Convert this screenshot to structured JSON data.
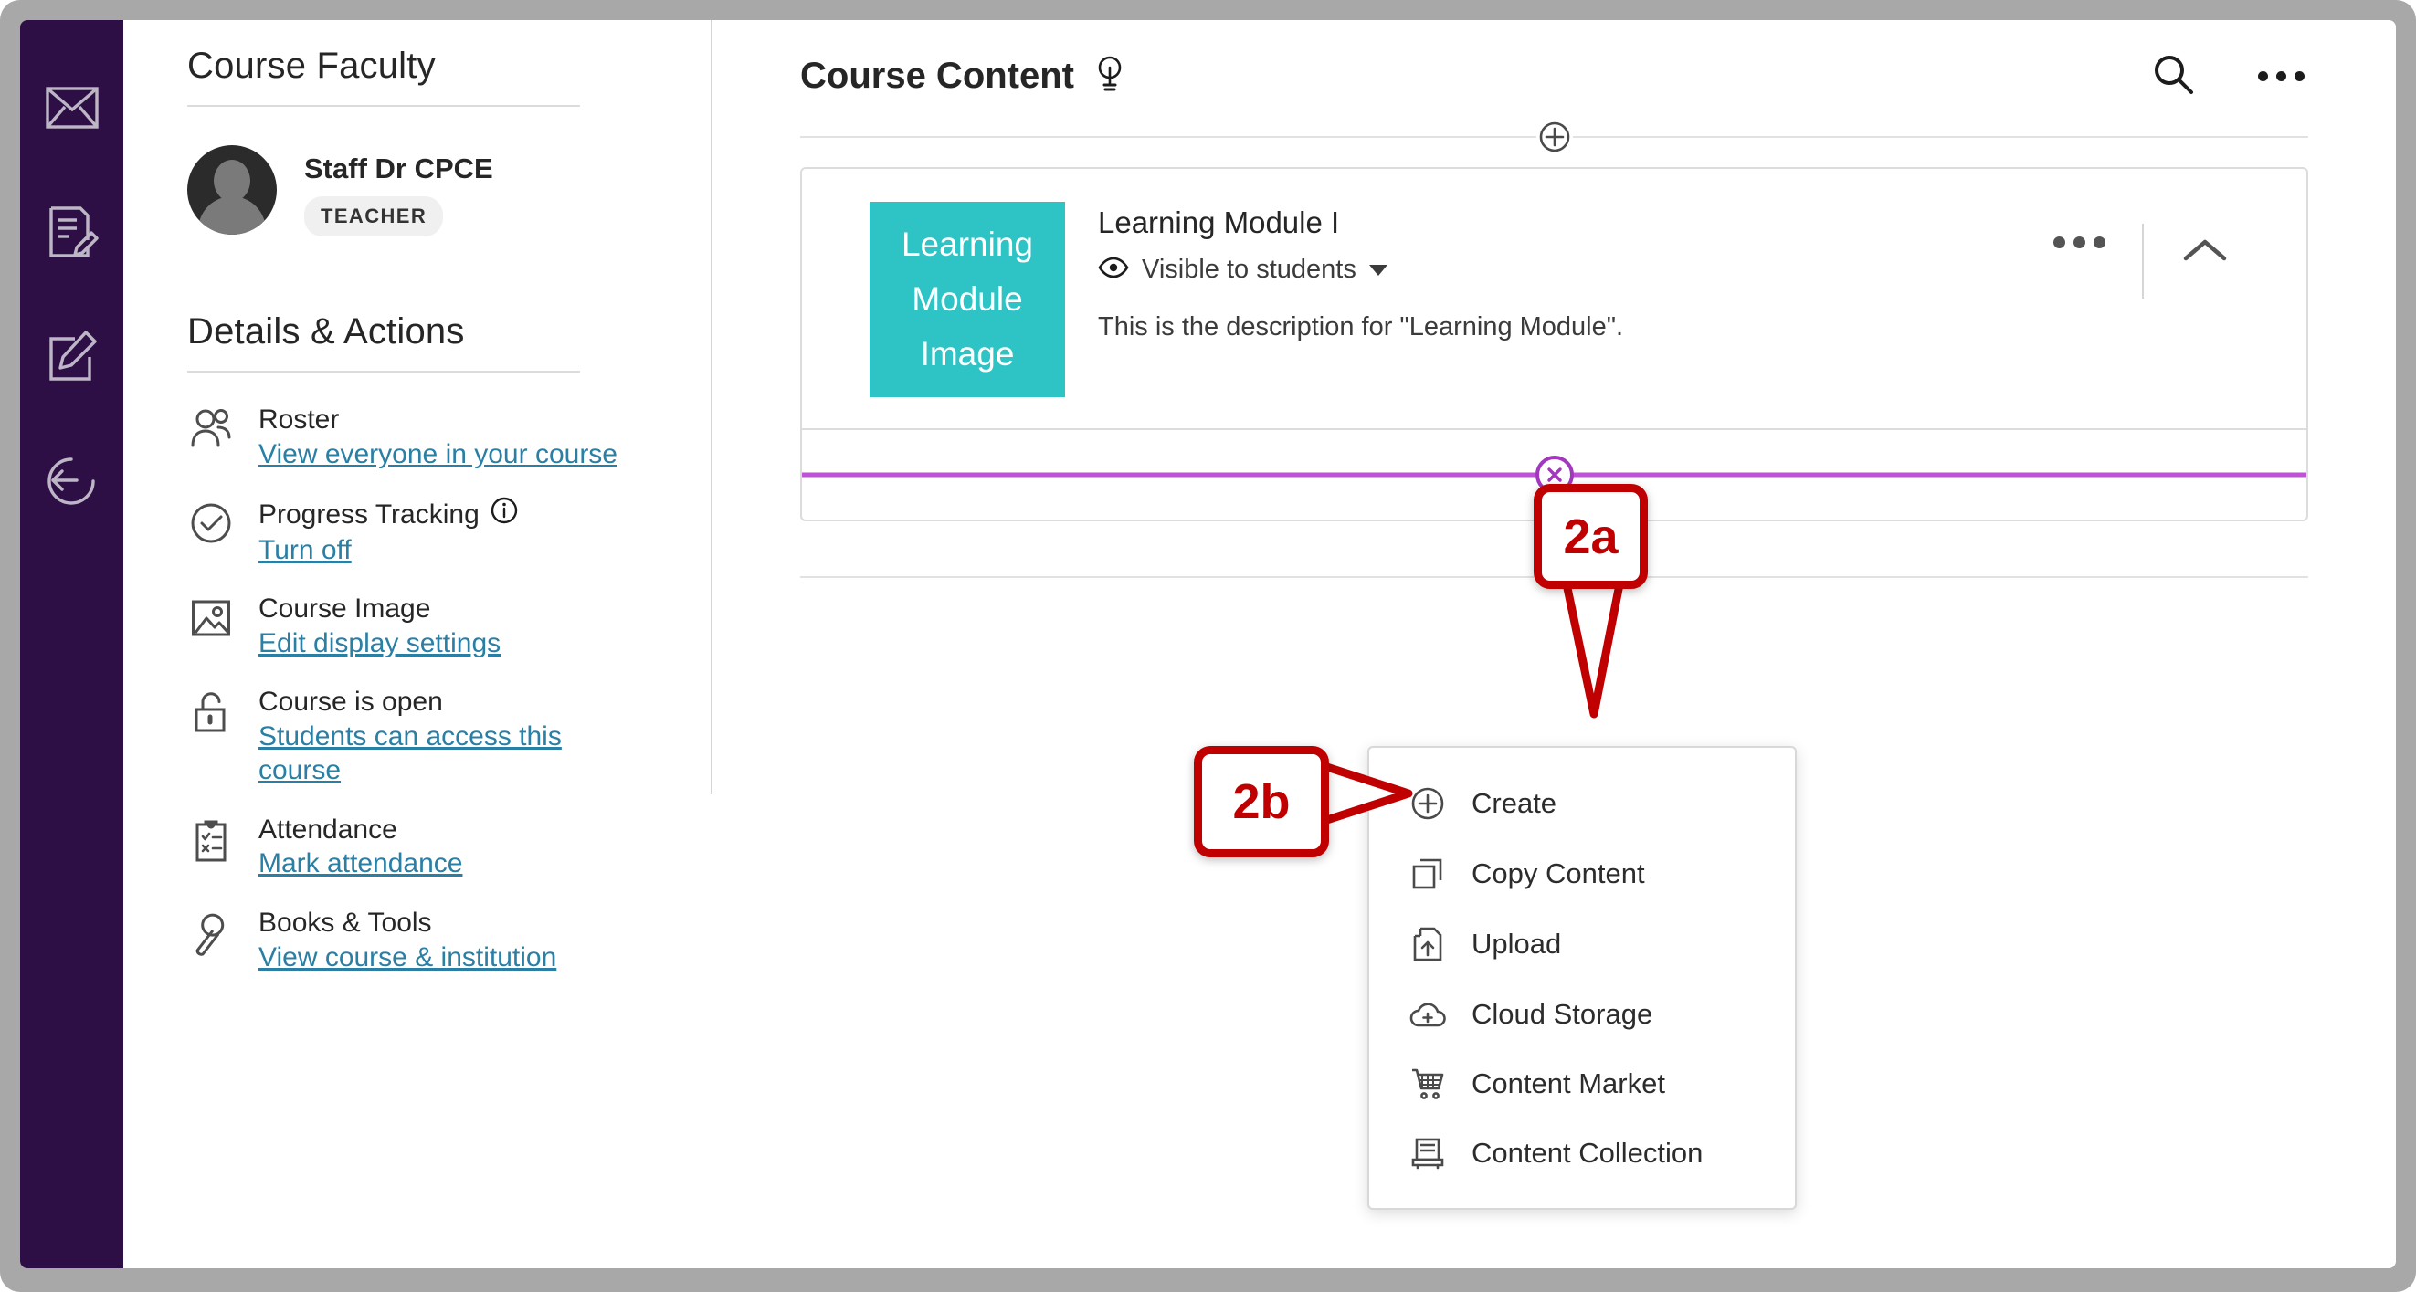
{
  "rail": {
    "items": [
      {
        "name": "messages",
        "icon": "envelope-icon"
      },
      {
        "name": "gradebook",
        "icon": "document-edit-icon"
      },
      {
        "name": "compose",
        "icon": "square-pencil-icon"
      },
      {
        "name": "return",
        "icon": "circular-arrow-left-icon"
      }
    ]
  },
  "faculty_panel": {
    "heading": "Course Faculty",
    "member": {
      "name": "Staff Dr CPCE",
      "role_badge": "TEACHER"
    }
  },
  "details_panel": {
    "heading": "Details & Actions",
    "items": [
      {
        "icon": "people-icon",
        "title": "Roster",
        "link": "View everyone in your course"
      },
      {
        "icon": "check-circle-icon",
        "title": "Progress Tracking",
        "link": "Turn off",
        "info_icon": "info-icon"
      },
      {
        "icon": "image-icon",
        "title": "Course Image",
        "link": "Edit display settings"
      },
      {
        "icon": "unlock-icon",
        "title": "Course is open",
        "link": "Students can access this course"
      },
      {
        "icon": "clipboard-icon",
        "title": "Attendance",
        "link": "Mark attendance"
      },
      {
        "icon": "wrench-icon",
        "title": "Books & Tools",
        "link": "View course & institution"
      }
    ]
  },
  "main": {
    "title": "Course Content",
    "bulb_icon": "lightbulb-icon",
    "search_icon": "search-icon",
    "overflow_icon": "more-options-icon",
    "add_content_icon": "plus-circle-icon"
  },
  "module": {
    "thumbnail_lines": [
      "Learning",
      "Module",
      "Image"
    ],
    "thumbnail_color": "#2EC4C6",
    "title": "Learning Module I",
    "visibility_icon": "eye-icon",
    "visibility_label": "Visible to students",
    "description": "This is the description for \"Learning Module\".",
    "overflow_icon": "more-options-icon",
    "collapse_icon": "chevron-up-icon",
    "drop_indicator_icon": "close-circle-icon",
    "drop_indicator_color": "#BF52D6"
  },
  "create_menu": {
    "items": [
      {
        "icon": "plus-circle-icon",
        "label": "Create"
      },
      {
        "icon": "copy-icon",
        "label": "Copy Content"
      },
      {
        "icon": "upload-file-icon",
        "label": "Upload"
      },
      {
        "icon": "cloud-plus-icon",
        "label": "Cloud Storage"
      },
      {
        "icon": "shopping-cart-icon",
        "label": "Content Market"
      },
      {
        "icon": "content-collection-icon",
        "label": "Content Collection"
      }
    ]
  },
  "callouts": {
    "a": "2a",
    "b": "2b",
    "color": "#C00000"
  }
}
